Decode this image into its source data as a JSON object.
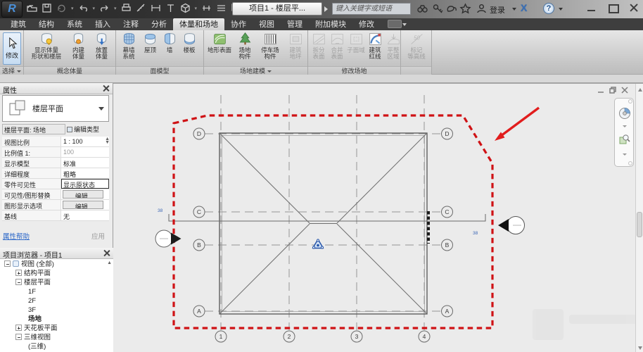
{
  "titlebar": {
    "logo_letter": "R",
    "doc_title": "项目1 - 楼层平...",
    "search_placeholder": "键入关键字或短语",
    "signin_label": "登录",
    "help_glyph": "?",
    "exchange_glyph": "X"
  },
  "tabs": {
    "items": [
      "建筑",
      "结构",
      "系统",
      "插入",
      "注释",
      "分析",
      "体量和场地",
      "协作",
      "视图",
      "管理",
      "附加模块",
      "修改"
    ]
  },
  "ribbon": {
    "select": {
      "caption": "选择",
      "modify_label": "修改"
    },
    "conceptual_mass": {
      "caption": "概念体量",
      "buttons": [
        {
          "label": "显示体量\n形状和楼层"
        },
        {
          "label": "内建\n体量"
        },
        {
          "label": "放置\n体量"
        }
      ]
    },
    "model_by_face": {
      "caption": "面模型",
      "buttons": [
        {
          "label": "幕墙\n系统"
        },
        {
          "label": "屋顶"
        },
        {
          "label": "墙"
        },
        {
          "label": "楼板"
        }
      ]
    },
    "site_modeling": {
      "caption": "场地建模",
      "buttons": [
        {
          "label": "地形表面"
        },
        {
          "label": "场地\n构件"
        },
        {
          "label": "停车场\n构件"
        },
        {
          "label": "建筑\n地坪"
        }
      ]
    },
    "modify_site": {
      "caption": "修改场地",
      "buttons": [
        {
          "label": "拆分\n表面"
        },
        {
          "label": "合并\n表面"
        },
        {
          "label": "子面域"
        },
        {
          "label": "建筑\n红线"
        },
        {
          "label": "平整\n区域"
        }
      ]
    },
    "contours": {
      "caption": "",
      "icon_text": "50",
      "label": "标记\n等高线"
    }
  },
  "properties": {
    "title": "属性",
    "type_selector": "楼层平面",
    "instance_selector": "楼层平面: 场地",
    "edit_type": "编辑类型",
    "rows": [
      {
        "label": "视图比例",
        "value": "1 : 100"
      },
      {
        "label": "比例值 1:",
        "value": "100"
      },
      {
        "label": "显示模型",
        "value": "标准"
      },
      {
        "label": "详细程度",
        "value": "粗略"
      },
      {
        "label": "零件可见性",
        "value": "显示原状态"
      },
      {
        "label": "可见性/图形替换",
        "value": "编辑..."
      },
      {
        "label": "图形显示选项",
        "value": "编辑..."
      },
      {
        "label": "基线",
        "value": "无"
      }
    ],
    "help_link": "属性帮助",
    "apply_label": "应用"
  },
  "browser": {
    "title": "项目浏览器 - 项目1",
    "items": [
      {
        "label": "视图 (全部)"
      },
      {
        "label": "结构平面"
      },
      {
        "label": "楼层平面"
      },
      {
        "label": "1F"
      },
      {
        "label": "2F"
      },
      {
        "label": "3F"
      },
      {
        "label": "场地"
      },
      {
        "label": "天花板平面"
      },
      {
        "label": "三维视图"
      },
      {
        "label": "(三维)"
      }
    ]
  },
  "canvas": {
    "grid_letters": [
      "D",
      "C",
      "B",
      "A"
    ],
    "grid_numbers": [
      "1",
      "2",
      "3",
      "4"
    ],
    "ref_label_left": "38",
    "ref_label_right": "38",
    "colors": {
      "red_line": "#cf1215",
      "arrow": "#e11d1d",
      "grid": "#949494",
      "building": "#5f5f5f",
      "survey": "#2453a8"
    }
  }
}
